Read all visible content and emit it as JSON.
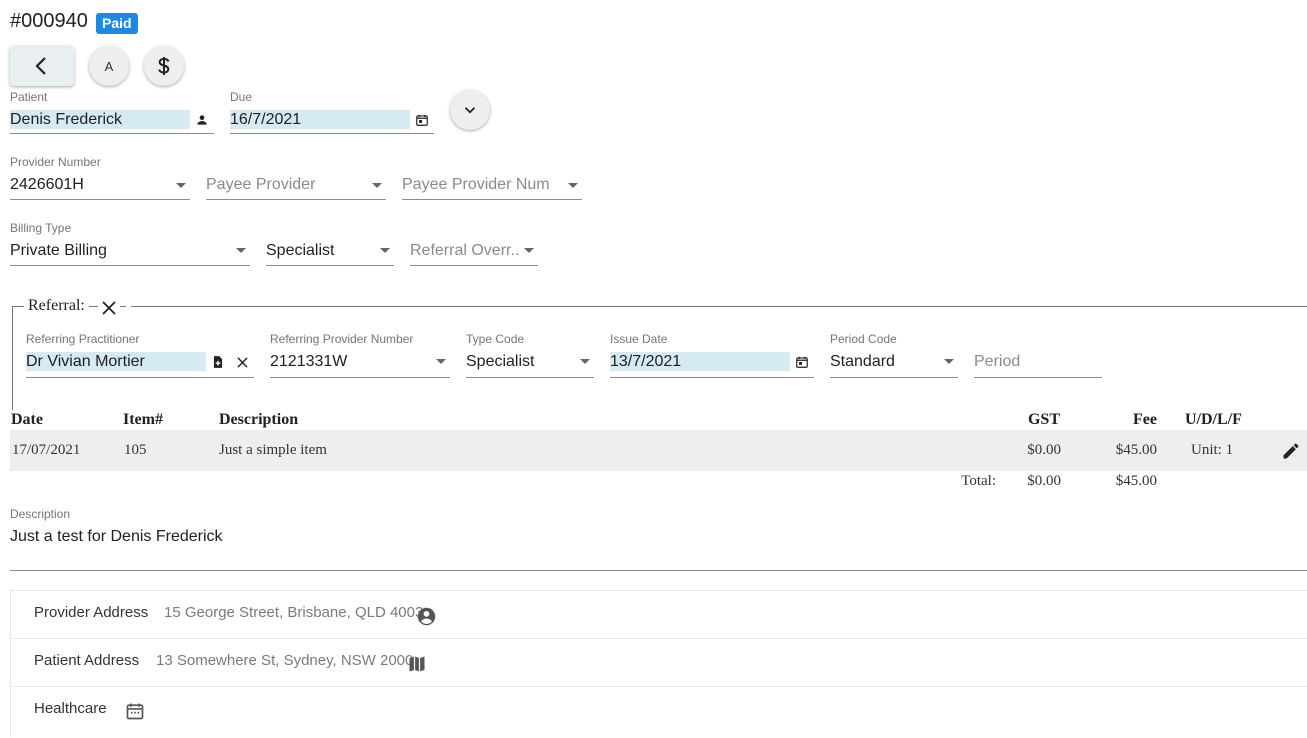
{
  "invoice": {
    "number": "#000940",
    "status": "Paid"
  },
  "toolbar": {
    "a_label": "A"
  },
  "patient": {
    "label": "Patient",
    "value": "Denis Frederick"
  },
  "due": {
    "label": "Due",
    "value": "16/7/2021"
  },
  "provider_number": {
    "label": "Provider Number",
    "value": "2426601H"
  },
  "payee_provider": {
    "placeholder": "Payee Provider"
  },
  "payee_provider_num": {
    "placeholder": "Payee Provider Num"
  },
  "billing_type": {
    "label": "Billing Type",
    "value": "Private Billing"
  },
  "specialist": {
    "value": "Specialist"
  },
  "referral_override": {
    "placeholder": "Referral Overr..."
  },
  "referral": {
    "legend": "Referral:",
    "practitioner": {
      "label": "Referring Practitioner",
      "value": "Dr Vivian Mortier"
    },
    "provider_number": {
      "label": "Referring Provider Number",
      "value": "2121331W"
    },
    "type_code": {
      "label": "Type Code",
      "value": "Specialist"
    },
    "issue_date": {
      "label": "Issue Date",
      "value": "13/7/2021"
    },
    "period_code": {
      "label": "Period Code",
      "value": "Standard"
    },
    "period": {
      "placeholder": "Period"
    }
  },
  "items_table": {
    "headers": {
      "date": "Date",
      "item": "Item#",
      "description": "Description",
      "gst": "GST",
      "fee": "Fee",
      "udlf": "U/D/L/F"
    },
    "rows": [
      {
        "date": "17/07/2021",
        "item": "105",
        "description": "Just a simple item",
        "gst": "$0.00",
        "fee": "$45.00",
        "udlf": "Unit: 1"
      }
    ],
    "total": {
      "label": "Total:",
      "gst": "$0.00",
      "fee": "$45.00"
    }
  },
  "description": {
    "label": "Description",
    "value": "Just a test for Denis Frederick"
  },
  "addresses": {
    "provider": {
      "label": "Provider Address",
      "value": "15 George Street, Brisbane, QLD 4003"
    },
    "patient": {
      "label": "Patient Address",
      "value": "13 Somewhere St, Sydney, NSW 2000"
    },
    "healthcare": {
      "label": "Healthcare"
    }
  }
}
